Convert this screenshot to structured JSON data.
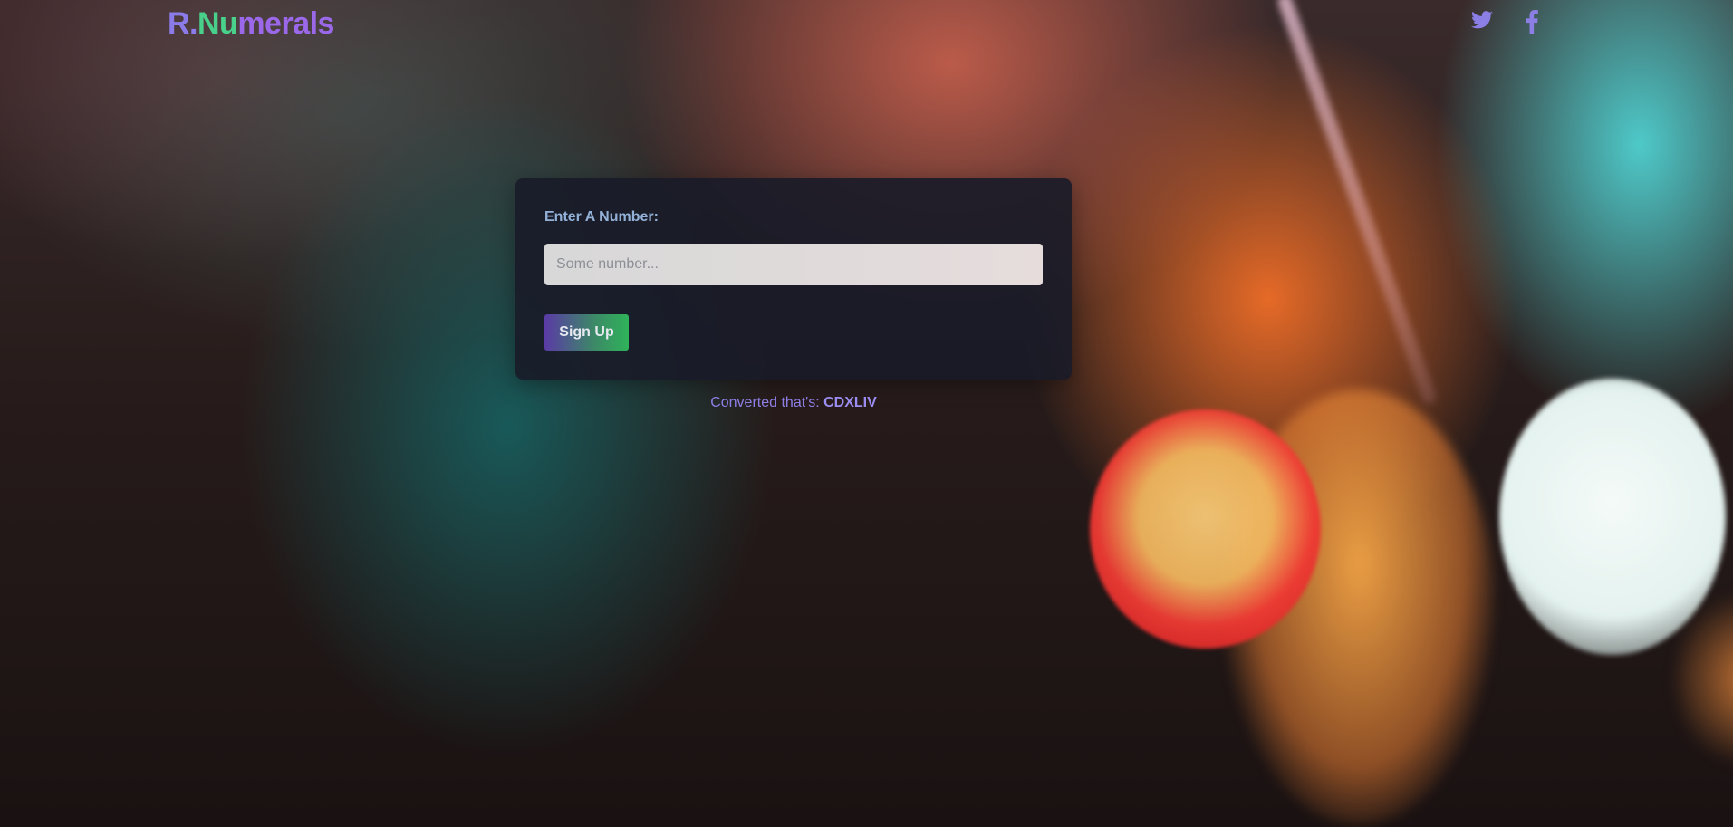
{
  "header": {
    "logo": {
      "part1": "R.",
      "part2": "Nu",
      "part3": "merals"
    },
    "social": [
      {
        "name": "twitter",
        "icon": "twitter-icon",
        "color": "#8b7fe6"
      },
      {
        "name": "facebook",
        "icon": "facebook-icon",
        "color": "#8b7fe6"
      }
    ]
  },
  "form": {
    "label": "Enter A Number:",
    "input": {
      "value": "",
      "placeholder": "Some number..."
    },
    "button_label": "Sign Up"
  },
  "result": {
    "prefix": "Converted that's: ",
    "value": "CDXLIV"
  },
  "colors": {
    "logo_purple": "#8a7be8",
    "logo_green": "#49d08a",
    "label_blue": "#93b1d8",
    "result_purple": "#8e7fe6",
    "button_gradient_start": "#5a3aa6",
    "button_gradient_end": "#2fb35a"
  }
}
